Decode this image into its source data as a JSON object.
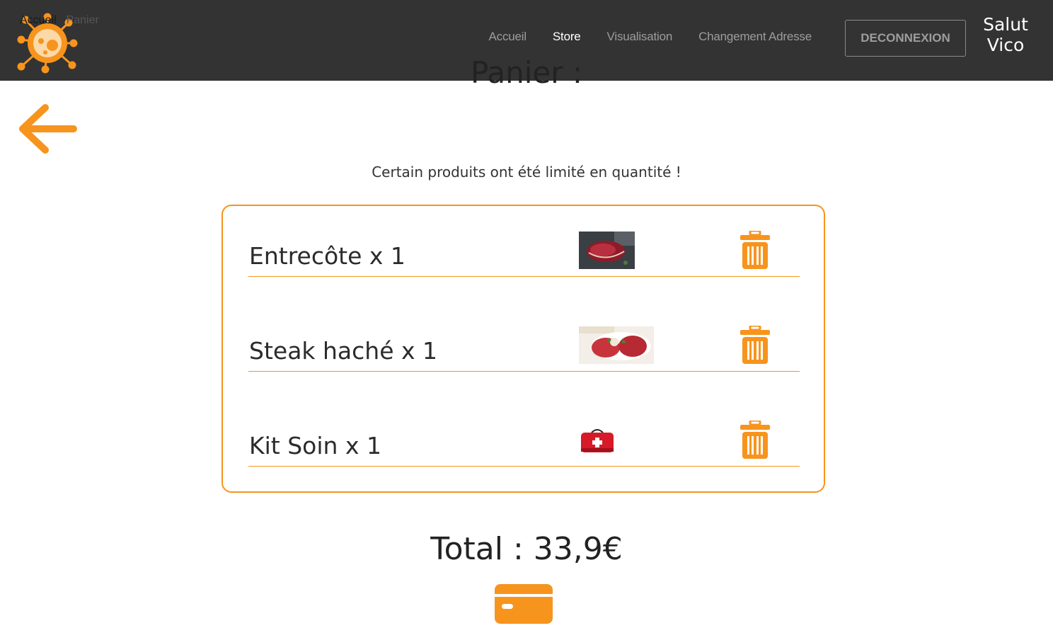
{
  "breadcrumb": {
    "home": "Accueil",
    "current": "Panier"
  },
  "nav": {
    "links": [
      "Accueil",
      "Store",
      "Visualisation",
      "Changement Adresse"
    ],
    "active": "Store",
    "logout_label": "DECONNEXION",
    "greeting_line1": "Salut",
    "greeting_line2": "Vico"
  },
  "page": {
    "title": "Panier :",
    "notice": "Certain produits ont été limité en quantité !",
    "total_label": "Total : 33,9€"
  },
  "cart": {
    "items": [
      {
        "label": "Entrecôte x 1",
        "image": "steak-photo"
      },
      {
        "label": "Steak haché x 1",
        "image": "minced-steak-photo"
      },
      {
        "label": "Kit Soin x 1",
        "image": "first-aid-kit-photo"
      }
    ]
  },
  "icons": {
    "logo": "virus-logo-icon",
    "back": "arrow-left-icon",
    "delete": "trash-icon",
    "pay": "credit-card-icon"
  },
  "colors": {
    "accent": "#f7941d",
    "navbar": "#333333",
    "nav_inactive": "#9d9d9d",
    "nav_active": "#ffffff"
  }
}
